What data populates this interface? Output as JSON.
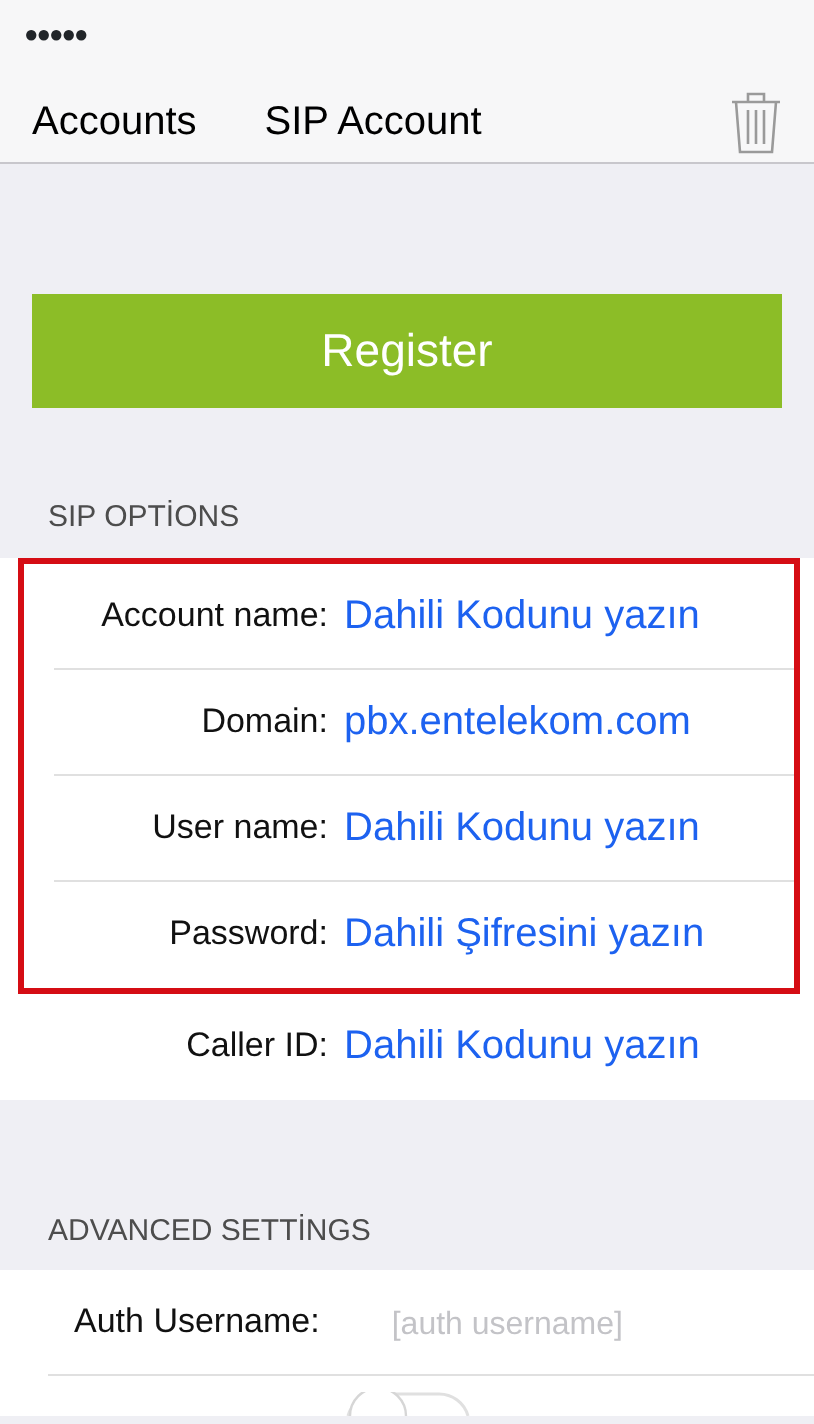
{
  "status_bar": {
    "signal": "●●●●●"
  },
  "nav": {
    "back": "Accounts",
    "title": "SIP Account"
  },
  "register_button": "Register",
  "sip_options": {
    "header": "SIP OPTİONS",
    "fields": [
      {
        "label": "Account name:",
        "value": "Dahili Kodunu yazın",
        "highlighted": true
      },
      {
        "label": "Domain:",
        "value": "pbx.entelekom.com",
        "highlighted": true
      },
      {
        "label": "User name:",
        "value": "Dahili Kodunu yazın",
        "highlighted": true
      },
      {
        "label": "Password:",
        "value": "Dahili Şifresini yazın",
        "highlighted": true
      },
      {
        "label": "Caller ID:",
        "value": "Dahili Kodunu yazın",
        "highlighted": false
      }
    ]
  },
  "advanced_settings": {
    "header": "ADVANCED SETTİNGS",
    "fields": [
      {
        "label": "Auth Username:",
        "placeholder": "[auth username]"
      }
    ],
    "toggle": {
      "on": false
    }
  }
}
